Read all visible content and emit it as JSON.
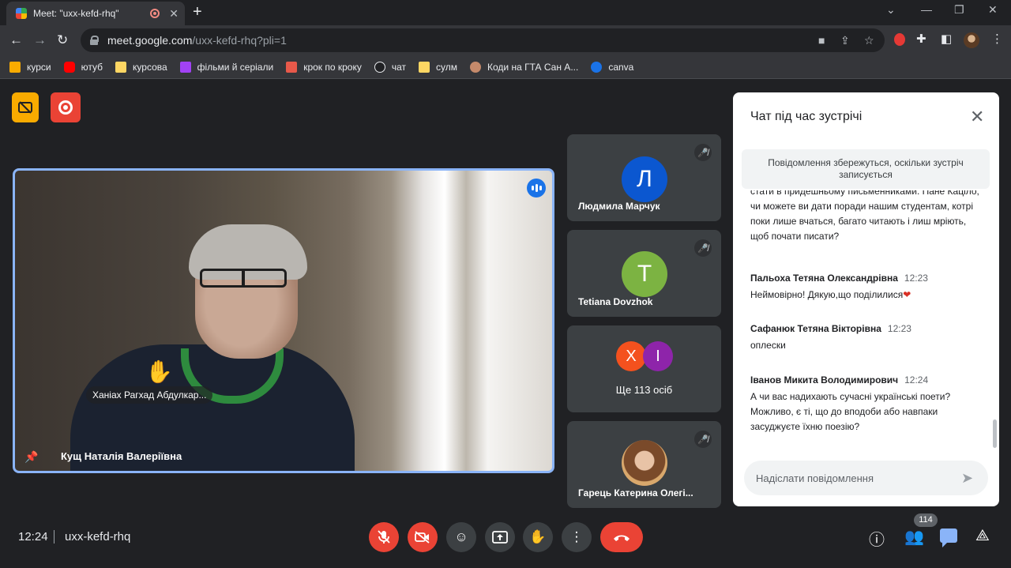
{
  "browser": {
    "tab_title": "Meet: \"uxx-kefd-rhq\"",
    "tab_close": "✕",
    "new_tab": "+",
    "url_host": "meet.google.com",
    "url_path": "/uxx-kefd-rhq?pli=1",
    "bookmarks": [
      {
        "label": "курси",
        "color": "#f9ab00"
      },
      {
        "label": "ютуб",
        "color": "#ff0000"
      },
      {
        "label": "курсова",
        "color": "#fdd663"
      },
      {
        "label": "фільми й серіали",
        "color": "#a142f4"
      },
      {
        "label": "крок по кроку",
        "color": "#e8594a"
      },
      {
        "label": "чат",
        "color": "#202124"
      },
      {
        "label": "сулм",
        "color": "#fdd663"
      },
      {
        "label": "Коди на ГТА Сан А...",
        "color": "#c58a6b"
      },
      {
        "label": "canva",
        "color": "#1a73e8"
      }
    ]
  },
  "stage": {
    "main_tile": {
      "name": "Кущ Наталія Валеріївна",
      "raised_hand_name": "Ханіах Рагхад Абдулкар..."
    },
    "side_tiles": [
      {
        "initial": "Л",
        "name": "Людмила Марчук",
        "color": "#0b57d0"
      },
      {
        "initial": "T",
        "name": "Tetiana Dovzhok",
        "color": "#7cb342"
      },
      {
        "more_label": "Ще 113 осіб",
        "initials": [
          "Х",
          "І"
        ],
        "colors": [
          "#f4511e",
          "#8e24aa"
        ]
      },
      {
        "name": "Гарець Катерина Олегі..."
      }
    ]
  },
  "chat": {
    "title": "Чат під час зустрічі",
    "note": "Повідомлення збережуться, оскільки зустріч записується",
    "partial_message": "стати в придешньому письменниками. Пане Каціло, чи можете ви дати поради нашим студентам, котрі поки лише вчаться, багато читають і лиш мріють, щоб почати писати?",
    "messages": [
      {
        "author": "Пальоха Тетяна Олександрівна",
        "time": "12:23",
        "text": "Неймовірно! Дякую,що поділилися"
      },
      {
        "author": "Сафанюк Тетяна Вікторівна",
        "time": "12:23",
        "text": "оплески"
      },
      {
        "author": "Іванов Микита Володимирович",
        "time": "12:24",
        "text": "А чи вас надихають сучасні українські поети? Можливо, є ті, що до вподоби або навпаки засуджуєте їхню поезію?"
      }
    ],
    "input_placeholder": "Надіслати повідомлення"
  },
  "bottom": {
    "time": "12:24",
    "meeting_code": "uxx-kefd-rhq",
    "participant_count": "114"
  }
}
